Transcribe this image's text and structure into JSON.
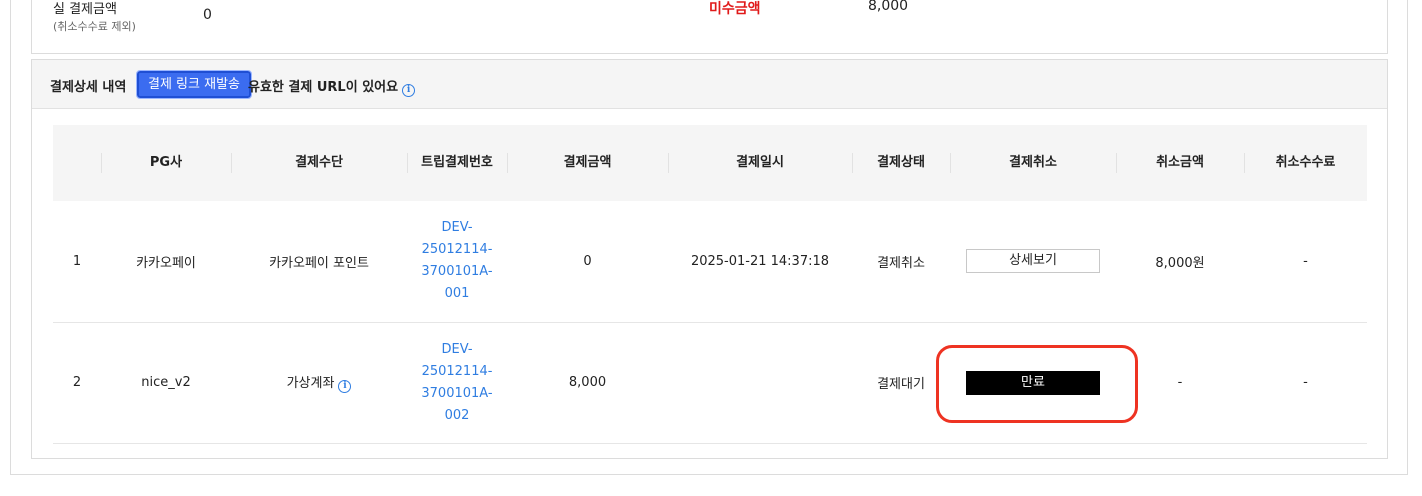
{
  "summary": {
    "actual_amount_label": "실 결제금액",
    "actual_amount_sub": "(취소수수료 제외)",
    "actual_amount_value": "0",
    "unpaid_label": "미수금액",
    "unpaid_value": "8,000"
  },
  "detail": {
    "title": "결제상세 내역",
    "resend_button": "결제 링크 재발송",
    "valid_url_text": "유효한 결제 URL이 있어요",
    "info_glyph": "i"
  },
  "table": {
    "headers": [
      "",
      "PG사",
      "결제수단",
      "트립결제번호",
      "결제금액",
      "결제일시",
      "결제상태",
      "결제취소",
      "취소금액",
      "취소수수료"
    ],
    "rows": [
      {
        "no": "1",
        "pg": "카카오페이",
        "method": "카카오페이 포인트",
        "trip_no_lines": [
          "DEV-",
          "25012114-",
          "3700101A-",
          "001"
        ],
        "amount": "0",
        "datetime": "2025-01-21 14:37:18",
        "status": "결제취소",
        "cancel_action": "상세보기",
        "cancel_amount": "8,000원",
        "cancel_fee": "-"
      },
      {
        "no": "2",
        "pg": "nice_v2",
        "method": "가상계좌",
        "trip_no_lines": [
          "DEV-",
          "25012114-",
          "3700101A-",
          "002"
        ],
        "amount": "8,000",
        "datetime": "",
        "status": "결제대기",
        "cancel_action": "만료",
        "cancel_amount": "-",
        "cancel_fee": "-"
      }
    ]
  },
  "colors": {
    "accent_blue": "#3b6cf0",
    "link_blue": "#2f7de1",
    "unpaid_red": "#e01a1a",
    "highlight_red": "#ee3322"
  },
  "icons": [
    "info-icon"
  ]
}
